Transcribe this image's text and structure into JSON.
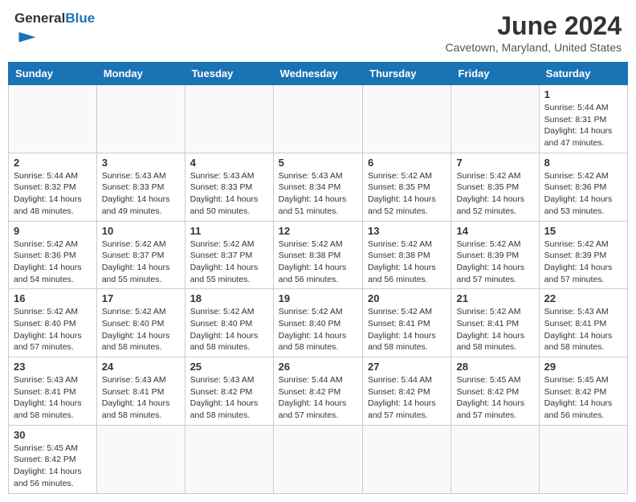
{
  "header": {
    "logo_general": "General",
    "logo_blue": "Blue",
    "title": "June 2024",
    "subtitle": "Cavetown, Maryland, United States"
  },
  "weekdays": [
    "Sunday",
    "Monday",
    "Tuesday",
    "Wednesday",
    "Thursday",
    "Friday",
    "Saturday"
  ],
  "weeks": [
    [
      {
        "day": "",
        "info": ""
      },
      {
        "day": "",
        "info": ""
      },
      {
        "day": "",
        "info": ""
      },
      {
        "day": "",
        "info": ""
      },
      {
        "day": "",
        "info": ""
      },
      {
        "day": "",
        "info": ""
      },
      {
        "day": "1",
        "info": "Sunrise: 5:44 AM\nSunset: 8:31 PM\nDaylight: 14 hours and 47 minutes."
      }
    ],
    [
      {
        "day": "2",
        "info": "Sunrise: 5:44 AM\nSunset: 8:32 PM\nDaylight: 14 hours and 48 minutes."
      },
      {
        "day": "3",
        "info": "Sunrise: 5:43 AM\nSunset: 8:33 PM\nDaylight: 14 hours and 49 minutes."
      },
      {
        "day": "4",
        "info": "Sunrise: 5:43 AM\nSunset: 8:33 PM\nDaylight: 14 hours and 50 minutes."
      },
      {
        "day": "5",
        "info": "Sunrise: 5:43 AM\nSunset: 8:34 PM\nDaylight: 14 hours and 51 minutes."
      },
      {
        "day": "6",
        "info": "Sunrise: 5:42 AM\nSunset: 8:35 PM\nDaylight: 14 hours and 52 minutes."
      },
      {
        "day": "7",
        "info": "Sunrise: 5:42 AM\nSunset: 8:35 PM\nDaylight: 14 hours and 52 minutes."
      },
      {
        "day": "8",
        "info": "Sunrise: 5:42 AM\nSunset: 8:36 PM\nDaylight: 14 hours and 53 minutes."
      }
    ],
    [
      {
        "day": "9",
        "info": "Sunrise: 5:42 AM\nSunset: 8:36 PM\nDaylight: 14 hours and 54 minutes."
      },
      {
        "day": "10",
        "info": "Sunrise: 5:42 AM\nSunset: 8:37 PM\nDaylight: 14 hours and 55 minutes."
      },
      {
        "day": "11",
        "info": "Sunrise: 5:42 AM\nSunset: 8:37 PM\nDaylight: 14 hours and 55 minutes."
      },
      {
        "day": "12",
        "info": "Sunrise: 5:42 AM\nSunset: 8:38 PM\nDaylight: 14 hours and 56 minutes."
      },
      {
        "day": "13",
        "info": "Sunrise: 5:42 AM\nSunset: 8:38 PM\nDaylight: 14 hours and 56 minutes."
      },
      {
        "day": "14",
        "info": "Sunrise: 5:42 AM\nSunset: 8:39 PM\nDaylight: 14 hours and 57 minutes."
      },
      {
        "day": "15",
        "info": "Sunrise: 5:42 AM\nSunset: 8:39 PM\nDaylight: 14 hours and 57 minutes."
      }
    ],
    [
      {
        "day": "16",
        "info": "Sunrise: 5:42 AM\nSunset: 8:40 PM\nDaylight: 14 hours and 57 minutes."
      },
      {
        "day": "17",
        "info": "Sunrise: 5:42 AM\nSunset: 8:40 PM\nDaylight: 14 hours and 58 minutes."
      },
      {
        "day": "18",
        "info": "Sunrise: 5:42 AM\nSunset: 8:40 PM\nDaylight: 14 hours and 58 minutes."
      },
      {
        "day": "19",
        "info": "Sunrise: 5:42 AM\nSunset: 8:40 PM\nDaylight: 14 hours and 58 minutes."
      },
      {
        "day": "20",
        "info": "Sunrise: 5:42 AM\nSunset: 8:41 PM\nDaylight: 14 hours and 58 minutes."
      },
      {
        "day": "21",
        "info": "Sunrise: 5:42 AM\nSunset: 8:41 PM\nDaylight: 14 hours and 58 minutes."
      },
      {
        "day": "22",
        "info": "Sunrise: 5:43 AM\nSunset: 8:41 PM\nDaylight: 14 hours and 58 minutes."
      }
    ],
    [
      {
        "day": "23",
        "info": "Sunrise: 5:43 AM\nSunset: 8:41 PM\nDaylight: 14 hours and 58 minutes."
      },
      {
        "day": "24",
        "info": "Sunrise: 5:43 AM\nSunset: 8:41 PM\nDaylight: 14 hours and 58 minutes."
      },
      {
        "day": "25",
        "info": "Sunrise: 5:43 AM\nSunset: 8:42 PM\nDaylight: 14 hours and 58 minutes."
      },
      {
        "day": "26",
        "info": "Sunrise: 5:44 AM\nSunset: 8:42 PM\nDaylight: 14 hours and 57 minutes."
      },
      {
        "day": "27",
        "info": "Sunrise: 5:44 AM\nSunset: 8:42 PM\nDaylight: 14 hours and 57 minutes."
      },
      {
        "day": "28",
        "info": "Sunrise: 5:45 AM\nSunset: 8:42 PM\nDaylight: 14 hours and 57 minutes."
      },
      {
        "day": "29",
        "info": "Sunrise: 5:45 AM\nSunset: 8:42 PM\nDaylight: 14 hours and 56 minutes."
      }
    ],
    [
      {
        "day": "30",
        "info": "Sunrise: 5:45 AM\nSunset: 8:42 PM\nDaylight: 14 hours and 56 minutes."
      },
      {
        "day": "",
        "info": ""
      },
      {
        "day": "",
        "info": ""
      },
      {
        "day": "",
        "info": ""
      },
      {
        "day": "",
        "info": ""
      },
      {
        "day": "",
        "info": ""
      },
      {
        "day": "",
        "info": ""
      }
    ]
  ]
}
